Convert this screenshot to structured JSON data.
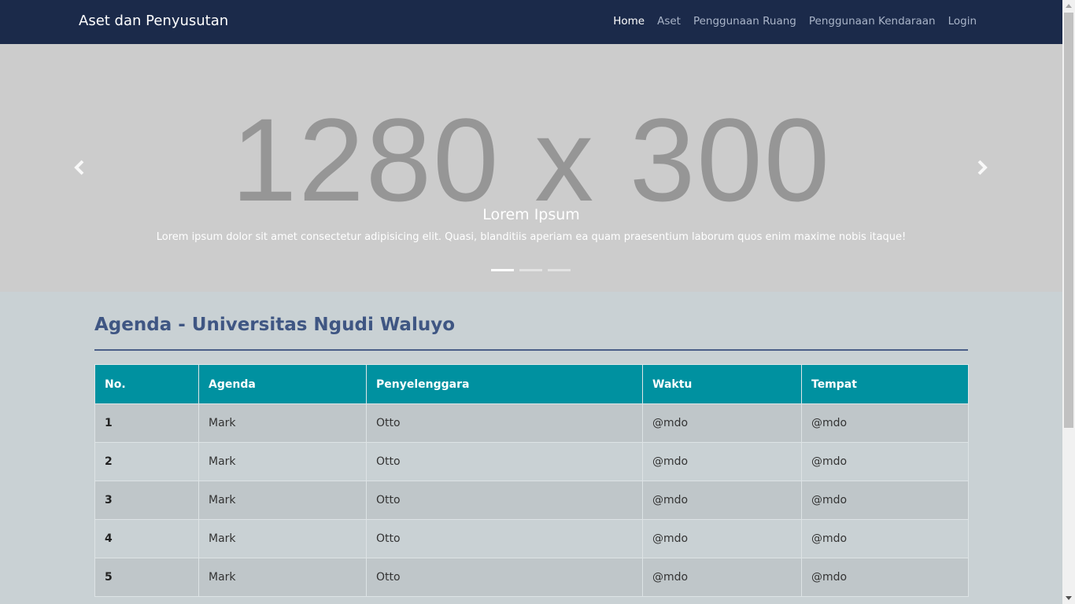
{
  "navbar": {
    "brand": "Aset dan Penyusutan",
    "items": [
      {
        "label": "Home",
        "active": true
      },
      {
        "label": "Aset",
        "active": false
      },
      {
        "label": "Penggunaan Ruang",
        "active": false
      },
      {
        "label": "Penggunaan Kendaraan",
        "active": false
      },
      {
        "label": "Login",
        "active": false
      }
    ]
  },
  "carousel": {
    "placeholder_text": "1280 x 300",
    "caption_title": "Lorem Ipsum",
    "caption_text": "Lorem ipsum dolor sit amet consectetur adipisicing elit. Quasi, blanditiis aperiam ea quam praesentium laborum quos enim maxime nobis itaque!",
    "prev_icon": "chevron-left-icon",
    "next_icon": "chevron-right-icon",
    "slide_count": 3,
    "active_slide": 1
  },
  "agenda": {
    "title": "Agenda - Universitas Ngudi Waluyo",
    "columns": [
      "No.",
      "Agenda",
      "Penyelenggara",
      "Waktu",
      "Tempat"
    ],
    "rows": [
      [
        "1",
        "Mark",
        "Otto",
        "@mdo",
        "@mdo"
      ],
      [
        "2",
        "Mark",
        "Otto",
        "@mdo",
        "@mdo"
      ],
      [
        "3",
        "Mark",
        "Otto",
        "@mdo",
        "@mdo"
      ],
      [
        "4",
        "Mark",
        "Otto",
        "@mdo",
        "@mdo"
      ],
      [
        "5",
        "Mark",
        "Otto",
        "@mdo",
        "@mdo"
      ]
    ]
  },
  "colors": {
    "navbar_bg": "#1b2a4a",
    "table_header_bg": "#0091a0",
    "title_color": "#3f5683",
    "page_bg": "#c9d1d4"
  }
}
